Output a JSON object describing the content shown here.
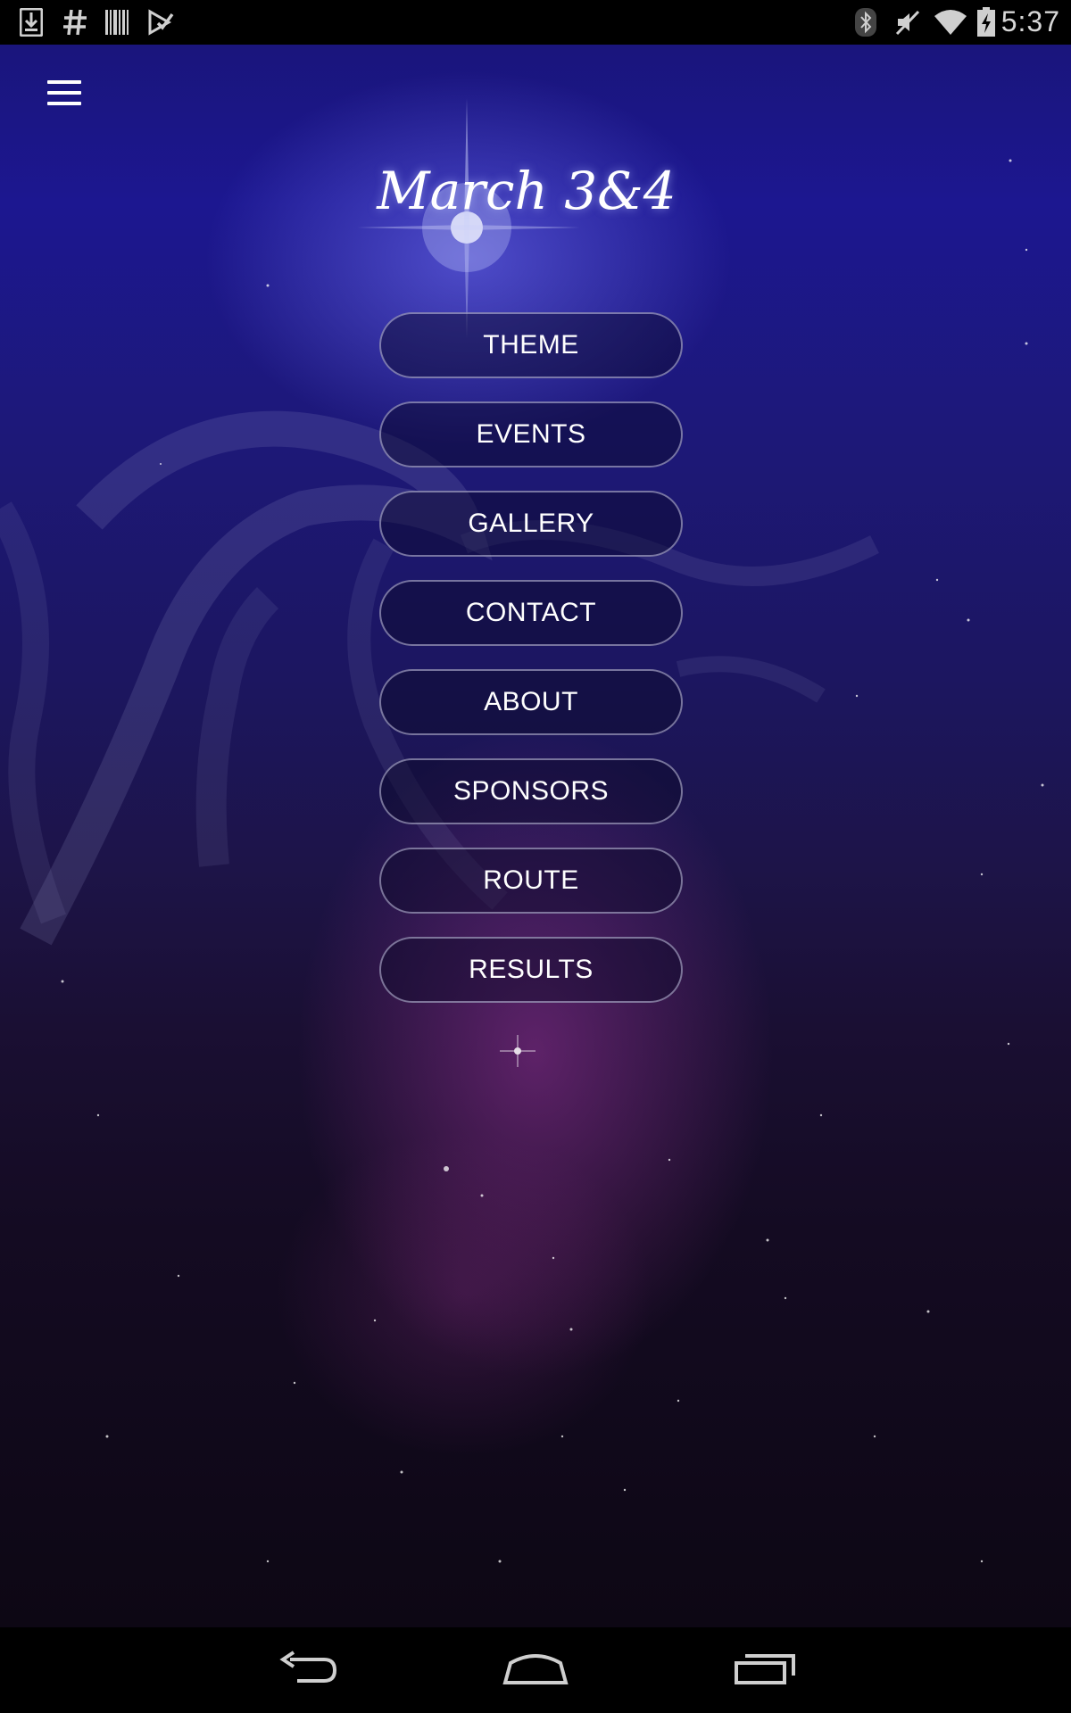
{
  "status_bar": {
    "time": "5:37",
    "left_icons": [
      "download-icon",
      "hashtag-icon",
      "barcode-icon",
      "play-store-icon"
    ],
    "right_icons": [
      "bluetooth-icon",
      "sound-muted-icon",
      "wifi-icon",
      "battery-charging-icon"
    ]
  },
  "app": {
    "title": "March 3&4",
    "menu_icon": "hamburger-icon",
    "nav_buttons": [
      {
        "label": "THEME"
      },
      {
        "label": "EVENTS"
      },
      {
        "label": "GALLERY"
      },
      {
        "label": "CONTACT"
      },
      {
        "label": "ABOUT"
      },
      {
        "label": "SPONSORS"
      },
      {
        "label": "ROUTE"
      },
      {
        "label": "RESULTS"
      }
    ],
    "colors": {
      "background_top": "#1c1790",
      "background_mid": "#1d1448",
      "background_bottom": "#0d0714",
      "button_border": "#c8c8e6",
      "text": "#ffffff"
    }
  },
  "system_nav": {
    "buttons": [
      "back-icon",
      "home-icon",
      "recent-apps-icon"
    ]
  }
}
